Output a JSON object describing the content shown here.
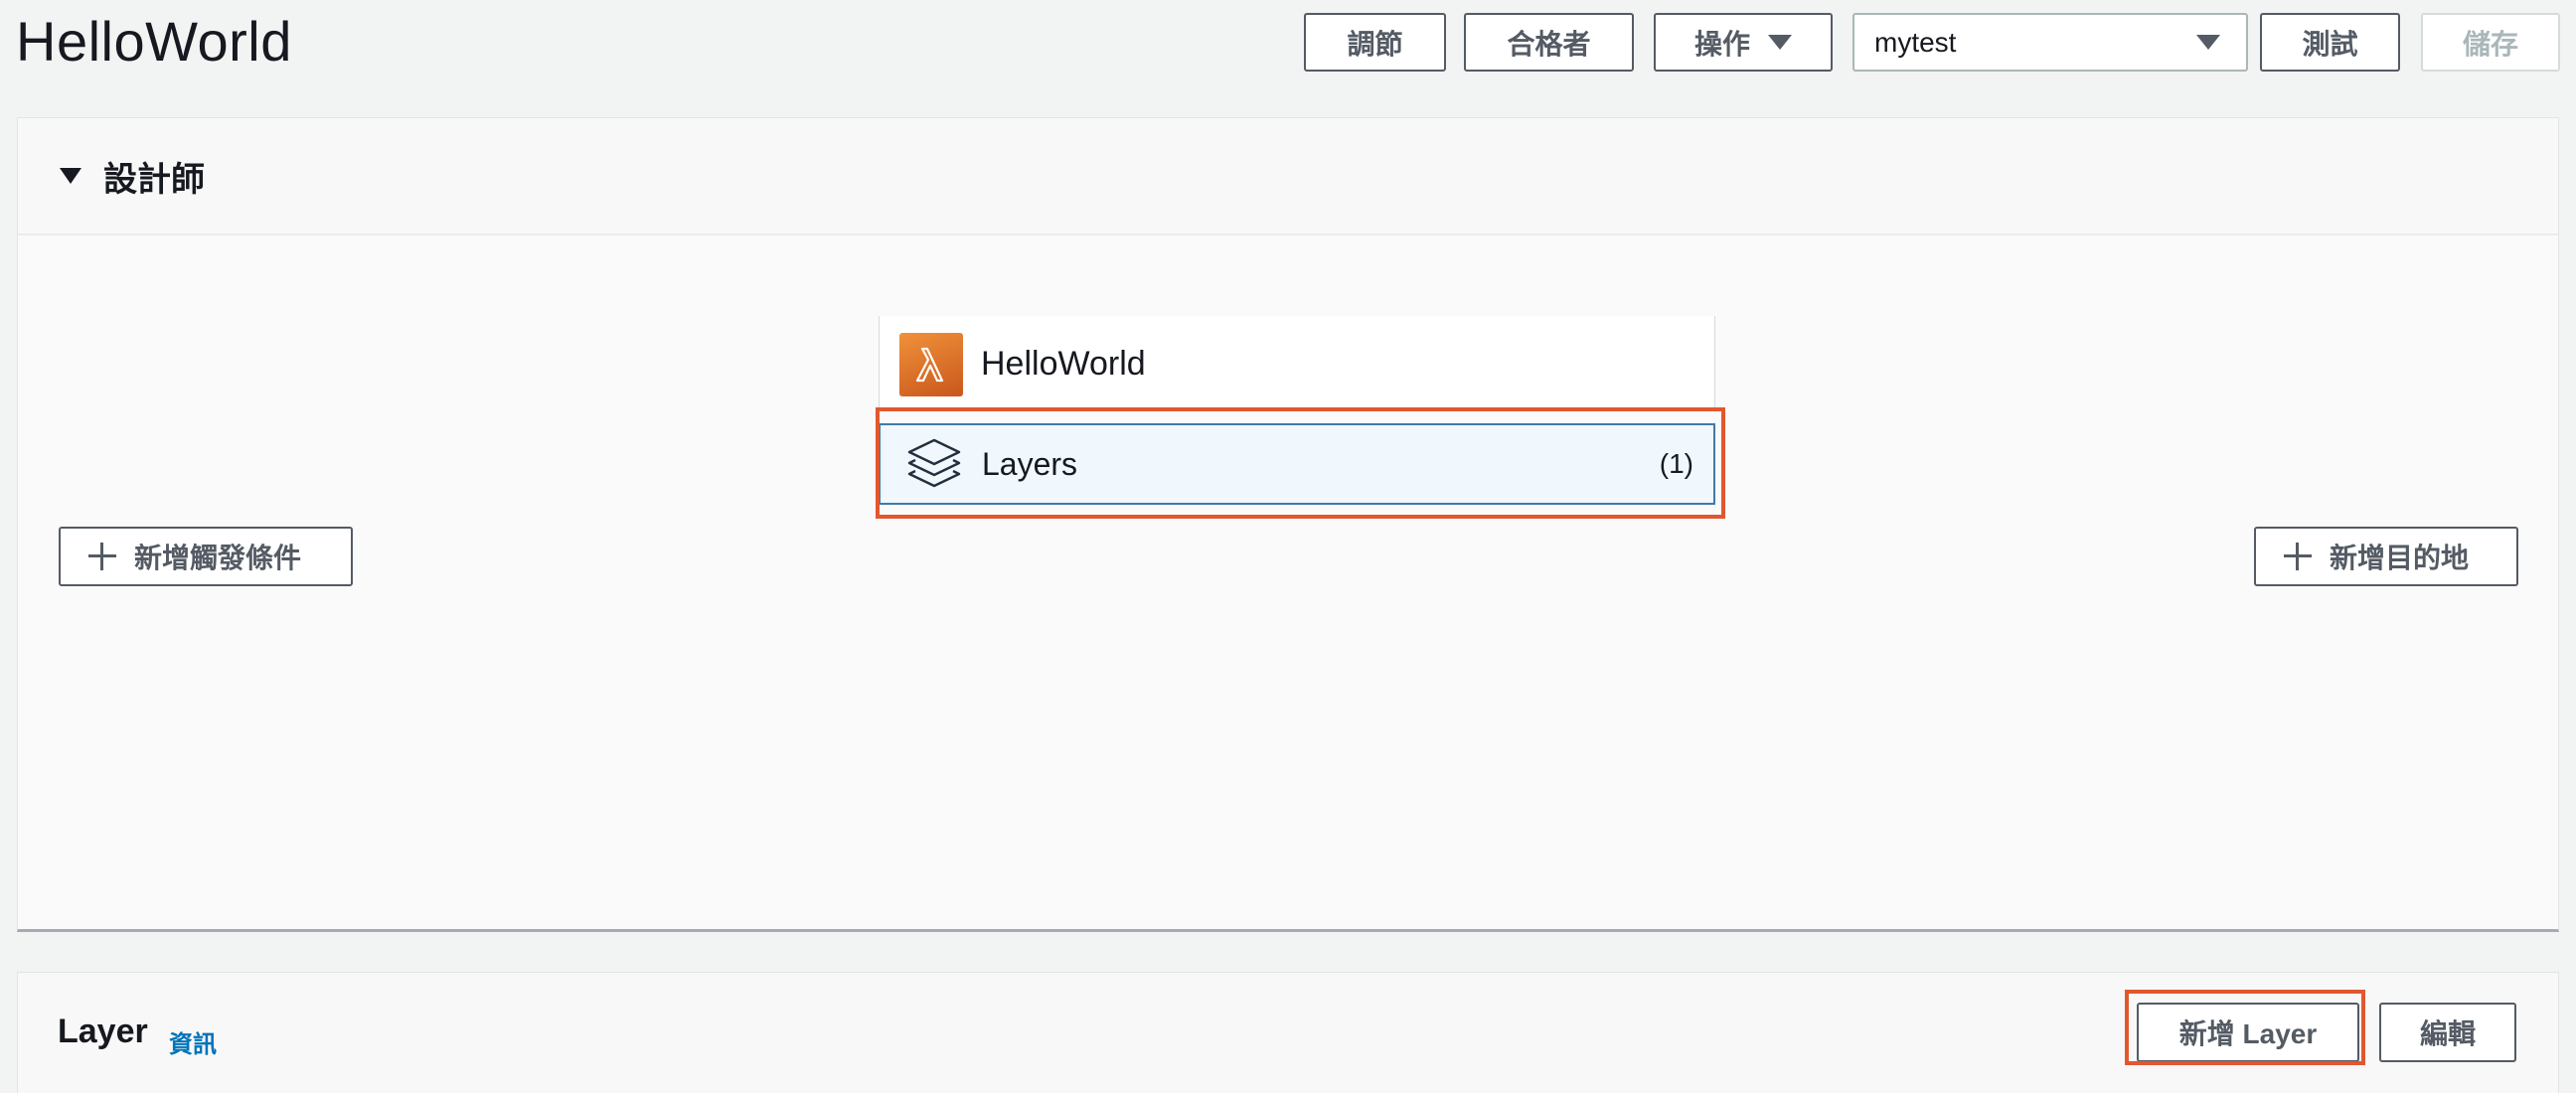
{
  "header": {
    "title": "HelloWorld",
    "buttons": {
      "throttle": "調節",
      "qualifiers": "合格者",
      "actions": "操作",
      "test": "測試",
      "save": "儲存"
    },
    "test_event_select": {
      "value": "mytest"
    }
  },
  "designer": {
    "title": "設計師",
    "function_name": "HelloWorld",
    "function_icon": "lambda-icon",
    "layers": {
      "label": "Layers",
      "count": "(1)",
      "icon": "layers-icon"
    },
    "add_trigger": "新增觸發條件",
    "add_destination": "新增目的地"
  },
  "layer_section": {
    "title": "Layer",
    "info_link": "資訊",
    "add_layer": "新增 Layer",
    "edit": "編輯"
  },
  "colors": {
    "highlight": "#e1582f",
    "link": "#0073bb",
    "layers_selected_bg": "#f0f8fd",
    "lambda_orange": "#e8812f"
  }
}
